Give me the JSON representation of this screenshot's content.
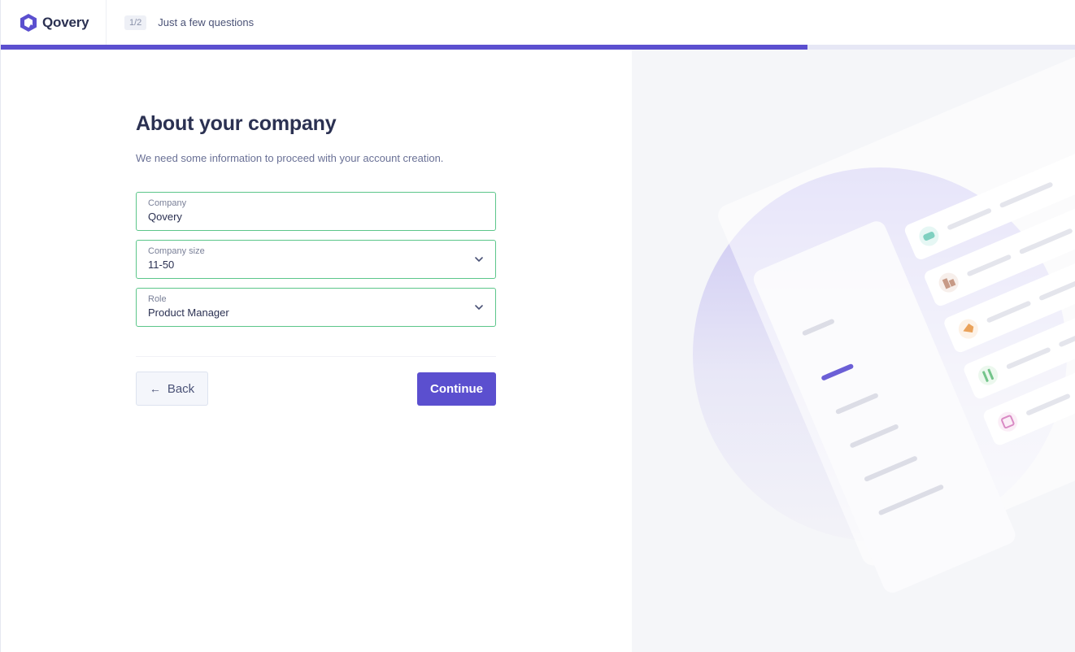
{
  "header": {
    "brand": "Qovery",
    "step": "1/2",
    "step_title": "Just a few questions",
    "progress_fraction": 0.75
  },
  "form": {
    "title": "About your company",
    "subtitle": "We need some information to proceed with your account creation.",
    "company": {
      "label": "Company",
      "value": "Qovery"
    },
    "company_size": {
      "label": "Company size",
      "value": "11-50"
    },
    "role": {
      "label": "Role",
      "value": "Product Manager"
    }
  },
  "actions": {
    "back_label": "Back",
    "continue_label": "Continue"
  },
  "colors": {
    "accent": "#5b4fcf",
    "field_border": "#5cc68a",
    "illustration_bg": "#f5f6f9"
  }
}
